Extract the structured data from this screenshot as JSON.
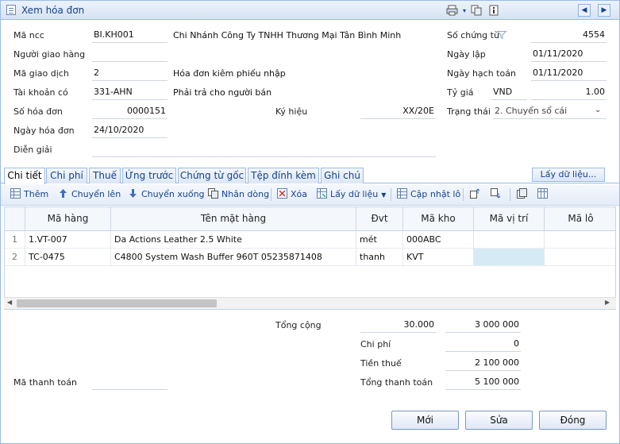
{
  "window": {
    "title": "Xem hóa đơn"
  },
  "header": {
    "ma_ncc_label": "Mã ncc",
    "ma_ncc_value": "BI.KH001",
    "ncc_name": "Chi Nhánh Công Ty TNHH Thương Mại Tân Bình Minh",
    "nguoi_giao_label": "Người giao hàng",
    "nguoi_giao_value": "",
    "ma_gd_label": "Mã giao dịch",
    "ma_gd_value": "2",
    "ma_gd_desc": "Hóa đơn kiêm phiếu nhập",
    "tk_co_label": "Tài khoản có",
    "tk_co_value": "331-AHN",
    "tk_co_desc": "Phải trả cho người bán",
    "so_hd_label": "Số hóa đơn",
    "so_hd_value": "0000151",
    "ky_hieu_label": "Ký hiệu",
    "ky_hieu_value": "XX/20E",
    "ngay_hd_label": "Ngày hóa đơn",
    "ngay_hd_value": "24/10/2020",
    "dien_giai_label": "Diễn giải",
    "dien_giai_value": "",
    "so_ct_label": "Số chứng từ",
    "so_ct_value": "4554",
    "ngay_lap_label": "Ngày lập",
    "ngay_lap_value": "01/11/2020",
    "ngay_ht_label": "Ngày hạch toán",
    "ngay_ht_value": "01/11/2020",
    "ty_gia_label": "Tỷ giá",
    "ty_gia_currency": "VND",
    "ty_gia_value": "1.00",
    "trang_thai_label": "Trạng thái",
    "trang_thai_value": "2. Chuyển sổ cái"
  },
  "tabs": [
    "Chi tiết",
    "Chi phí",
    "Thuế",
    "Ứng trước",
    "Chứng từ gốc",
    "Tệp đính kèm",
    "Ghi chú"
  ],
  "lay_du_lieu_button": "Lấy dữ liệu...",
  "toolbar": {
    "them": "Thêm",
    "chuyen_len": "Chuyển lên",
    "chuyen_xuong": "Chuyển xuống",
    "nhan_dong": "Nhân dòng",
    "xoa": "Xóa",
    "lay_du_lieu": "Lấy dữ liệu",
    "cap_nhat_lo": "Cập nhật lô"
  },
  "grid": {
    "columns": [
      "Mã hàng",
      "Tên mặt hàng",
      "Đvt",
      "Mã kho",
      "Mã vị trí",
      "Mã lô"
    ],
    "rows": [
      {
        "num": "1",
        "ma_hang": "1.VT-007",
        "ten": "Da Actions Leather 2.5 White",
        "dvt": "mét",
        "ma_kho": "000ABC",
        "vi_tri": "",
        "lo": ""
      },
      {
        "num": "2",
        "ma_hang": "TC-0475",
        "ten": "C4800 System Wash Buffer 960T 05235871408",
        "dvt": "thanh",
        "ma_kho": "KVT",
        "vi_tri": "",
        "lo": ""
      }
    ]
  },
  "totals": {
    "tong_cong_label": "Tổng cộng",
    "tong_cong_qty": "30.000",
    "tong_cong_amount": "3 000 000",
    "chi_phi_label": "Chi phí",
    "chi_phi_value": "0",
    "tien_thue_label": "Tiền thuế",
    "tien_thue_value": "2 100 000",
    "tong_tt_label": "Tổng thanh toán",
    "tong_tt_value": "5 100 000",
    "ma_tt_label": "Mã thanh toán",
    "ma_tt_value": ""
  },
  "buttons": {
    "moi": "Mới",
    "sua": "Sửa",
    "dong": "Đóng"
  },
  "colors": {
    "accent": "#15428b",
    "border": "#99bbe8",
    "selected_cell": "#d6eaf5"
  }
}
